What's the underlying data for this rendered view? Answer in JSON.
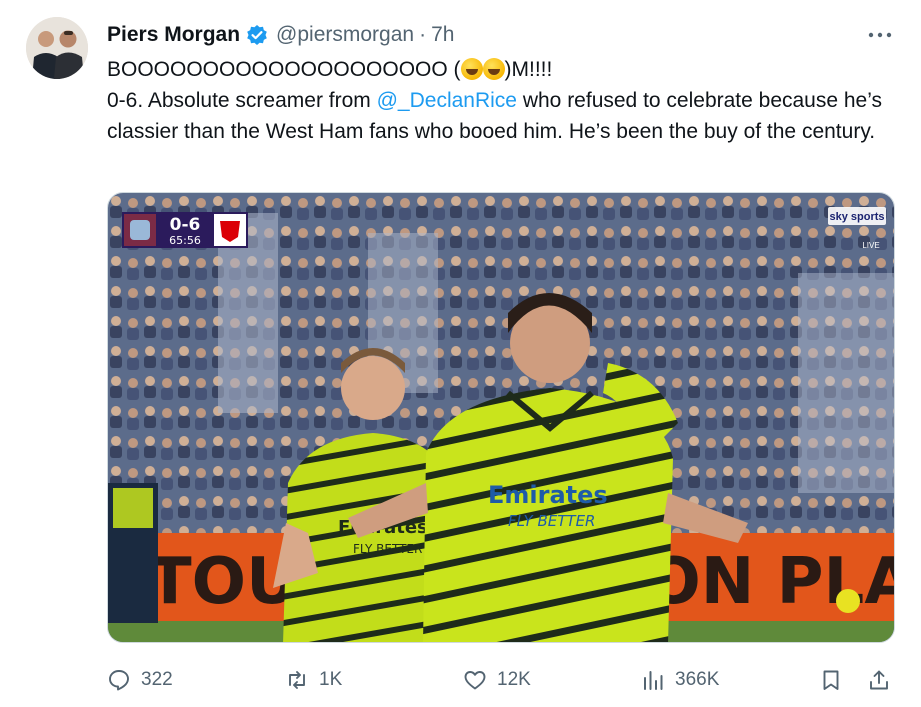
{
  "author": {
    "display_name": "Piers Morgan",
    "handle": "@piersmorgan",
    "separator": "·",
    "time": "7h",
    "verified": true
  },
  "tweet": {
    "line1_start": "BOOOOOOOOOOOOOOOOOOOO (",
    "line1_end": ")M!!!!",
    "emoji": "rolling-on-floor-laughing",
    "body_before_mention": "0-6. Absolute screamer from ",
    "mention": "@_DeclanRice",
    "body_after_mention": " who refused to celebrate because he’s classier than the West Ham fans who booed him. He’s been the buy of the century."
  },
  "media": {
    "score": "0-6",
    "clock": "65:56",
    "broadcaster": "sky sports",
    "broadcaster_sub": "Premier League",
    "live_label": "LIVE",
    "sponsor_text": "Emirates",
    "sponsor_sub": "FLY BETTER",
    "board_text": "TOUC S ON PLAN",
    "colors": {
      "kit": "#c9e41c",
      "kit_stripe": "#1e2b1a",
      "board": "#e2561b",
      "stands": "#3c4a6e"
    }
  },
  "actions": {
    "replies": "322",
    "retweets": "1K",
    "likes": "12K",
    "views": "366K"
  }
}
